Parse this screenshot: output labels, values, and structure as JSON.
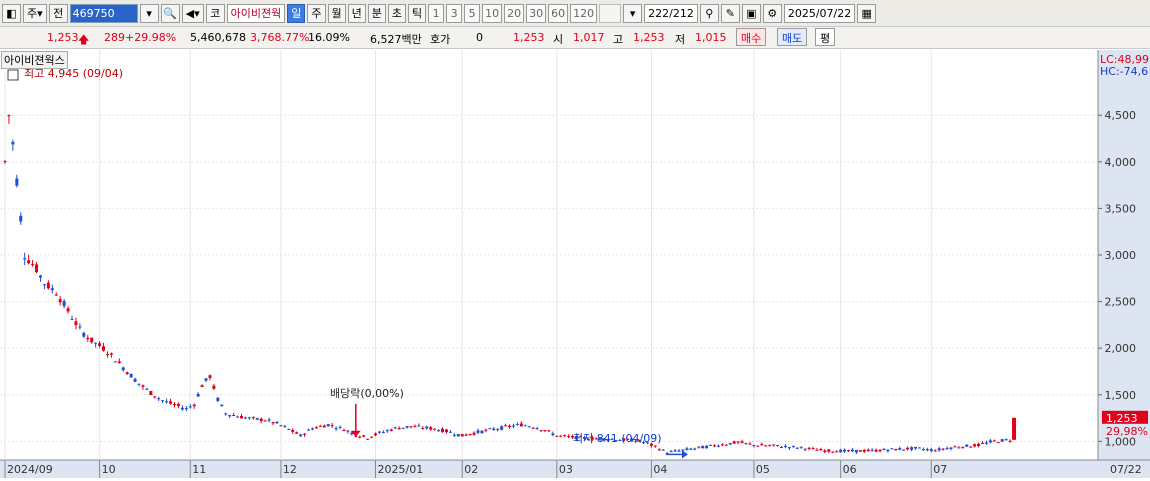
{
  "toolbar": {
    "market_label": "주",
    "prev_label": "전",
    "code": "469750",
    "name": "아이비젼웍",
    "type_label": "코",
    "periods": [
      "일",
      "주",
      "월",
      "년",
      "분",
      "초",
      "틱"
    ],
    "selected_period": "일",
    "minute_options": [
      "1",
      "3",
      "5",
      "10",
      "20",
      "30",
      "60",
      "120"
    ],
    "count": "222",
    "count_total": "/212",
    "date": "2025/07/22"
  },
  "info": {
    "price": "1,253",
    "change": "289",
    "change_pct": "+29.98%",
    "volume": "5,460,678",
    "volume_pct": "3,768.77%",
    "turnover": "16.09%",
    "amount": "6,527백만",
    "quote_label": "호가",
    "quote_value": "0",
    "quote_price": "1,253",
    "open_label": "시",
    "open": "1,017",
    "high_label": "고",
    "high": "1,253",
    "low_label": "저",
    "low": "1,015",
    "buy_label": "매수",
    "sell_label": "매도",
    "avg_label": "평"
  },
  "chart_data": {
    "type": "candlestick",
    "title": "아이비젼웍스",
    "y_ticks": [
      1000,
      1500,
      2000,
      2500,
      3000,
      3500,
      4000,
      4500
    ],
    "ylim": [
      800,
      5200
    ],
    "x_labels": [
      {
        "label": "2024/09",
        "day": 0
      },
      {
        "label": "10",
        "day": 24
      },
      {
        "label": "11",
        "day": 47
      },
      {
        "label": "12",
        "day": 70
      },
      {
        "label": "2025/01",
        "day": 94
      },
      {
        "label": "02",
        "day": 116
      },
      {
        "label": "03",
        "day": 140
      },
      {
        "label": "04",
        "day": 164
      },
      {
        "label": "05",
        "day": 190
      },
      {
        "label": "06",
        "day": 212
      },
      {
        "label": "07",
        "day": 235
      }
    ],
    "last_x_label": "07/22",
    "total_days": 257,
    "high_annotation": "최고 4,945 (09/04)",
    "low_annotation": "최저 841 (04/09)",
    "dividend_annotation": "배당락(0,00%)",
    "lc_label": "LC:48,99",
    "hc_label": "HC:-74,6",
    "current_price_label": "1,253",
    "current_change_label": "29,98%",
    "path_points": [
      [
        0,
        4000
      ],
      [
        1,
        4500
      ],
      [
        2,
        4200
      ],
      [
        3,
        3800
      ],
      [
        5,
        3000
      ],
      [
        8,
        2850
      ],
      [
        10,
        2700
      ],
      [
        13,
        2600
      ],
      [
        16,
        2400
      ],
      [
        19,
        2200
      ],
      [
        22,
        2080
      ],
      [
        25,
        2000
      ],
      [
        28,
        1880
      ],
      [
        31,
        1750
      ],
      [
        34,
        1620
      ],
      [
        37,
        1520
      ],
      [
        40,
        1440
      ],
      [
        43,
        1390
      ],
      [
        46,
        1350
      ],
      [
        48,
        1400
      ],
      [
        50,
        1600
      ],
      [
        52,
        1700
      ],
      [
        54,
        1450
      ],
      [
        56,
        1300
      ],
      [
        59,
        1270
      ],
      [
        63,
        1240
      ],
      [
        66,
        1230
      ],
      [
        69,
        1190
      ],
      [
        72,
        1130
      ],
      [
        75,
        1060
      ],
      [
        78,
        1140
      ],
      [
        82,
        1180
      ],
      [
        86,
        1130
      ],
      [
        89,
        1070
      ],
      [
        92,
        1040
      ],
      [
        95,
        1090
      ],
      [
        99,
        1140
      ],
      [
        103,
        1160
      ],
      [
        108,
        1140
      ],
      [
        112,
        1110
      ],
      [
        116,
        1060
      ],
      [
        120,
        1100
      ],
      [
        124,
        1130
      ],
      [
        128,
        1160
      ],
      [
        131,
        1180
      ],
      [
        134,
        1160
      ],
      [
        137,
        1120
      ],
      [
        140,
        1060
      ],
      [
        145,
        1040
      ],
      [
        150,
        1030
      ],
      [
        155,
        1020
      ],
      [
        160,
        1010
      ],
      [
        163,
        980
      ],
      [
        166,
        920
      ],
      [
        168,
        880
      ],
      [
        171,
        900
      ],
      [
        176,
        930
      ],
      [
        181,
        960
      ],
      [
        186,
        990
      ],
      [
        190,
        960
      ],
      [
        196,
        950
      ],
      [
        202,
        930
      ],
      [
        208,
        900
      ],
      [
        214,
        895
      ],
      [
        220,
        900
      ],
      [
        226,
        915
      ],
      [
        231,
        925
      ],
      [
        236,
        905
      ],
      [
        240,
        935
      ],
      [
        244,
        950
      ],
      [
        247,
        960
      ],
      [
        250,
        995
      ],
      [
        253,
        1010
      ],
      [
        255,
        1017
      ]
    ],
    "last_candle": {
      "day": 256,
      "open": 1017,
      "high": 1253,
      "low": 1015,
      "close": 1253
    }
  }
}
